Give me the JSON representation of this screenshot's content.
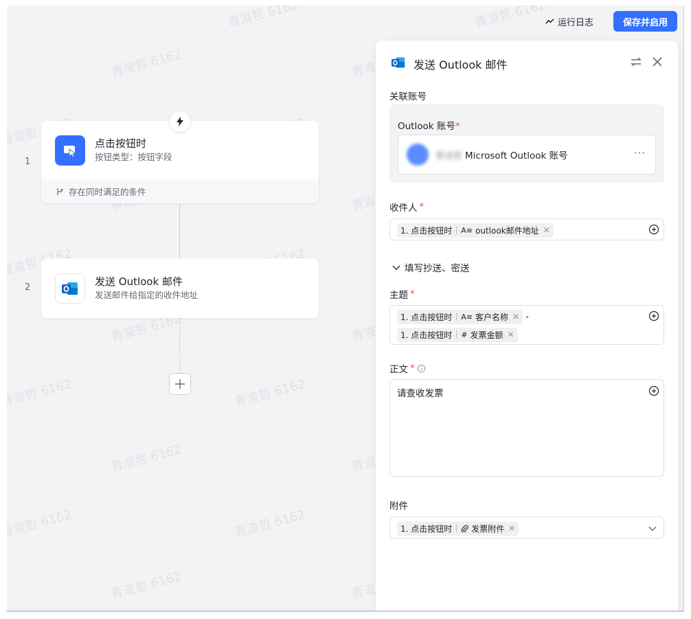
{
  "topbar": {
    "run_log": "运行日志",
    "save_enable": "保存并启用"
  },
  "flow": {
    "steps": [
      {
        "num": "1",
        "title": "点击按钮时",
        "subtitle": "按钮类型：按钮字段",
        "footer": "存在同时满足的条件"
      },
      {
        "num": "2",
        "title": "发送 Outlook 邮件",
        "subtitle": "发送邮件给指定的收件地址"
      }
    ]
  },
  "panel": {
    "title": "发送 Outlook 邮件",
    "linked_account_label": "关联账号",
    "outlook_account_label": "Outlook 账号",
    "account_blurred": "青浚哲 ",
    "account_name": "Microsoft Outlook 账号",
    "account_more": "···",
    "recipient_label": "收件人",
    "recipient_chip": {
      "source": "1. 点击按钮时",
      "field": "outlook邮件地址",
      "type_icon": "A≡"
    },
    "cc_toggle": "填写抄送、密送",
    "subject_label": "主题",
    "subject_chips": [
      {
        "source": "1. 点击按钮时",
        "field": "客户名称",
        "type_icon": "A≡"
      },
      {
        "source": "1. 点击按钮时",
        "field": "发票金额",
        "type_icon": "#"
      }
    ],
    "subject_separator": "-",
    "body_label": "正文",
    "body_text": "请查收发票",
    "attachment_label": "附件",
    "attachment_chip": {
      "source": "1. 点击按钮时",
      "field": "发票附件"
    },
    "required_mark": "*"
  },
  "watermark": "青浚哲 6162",
  "colors": {
    "primary": "#3370ff",
    "required": "#f54a45",
    "canvas": "#f2f3f5",
    "outlook": "#0a64c8"
  }
}
